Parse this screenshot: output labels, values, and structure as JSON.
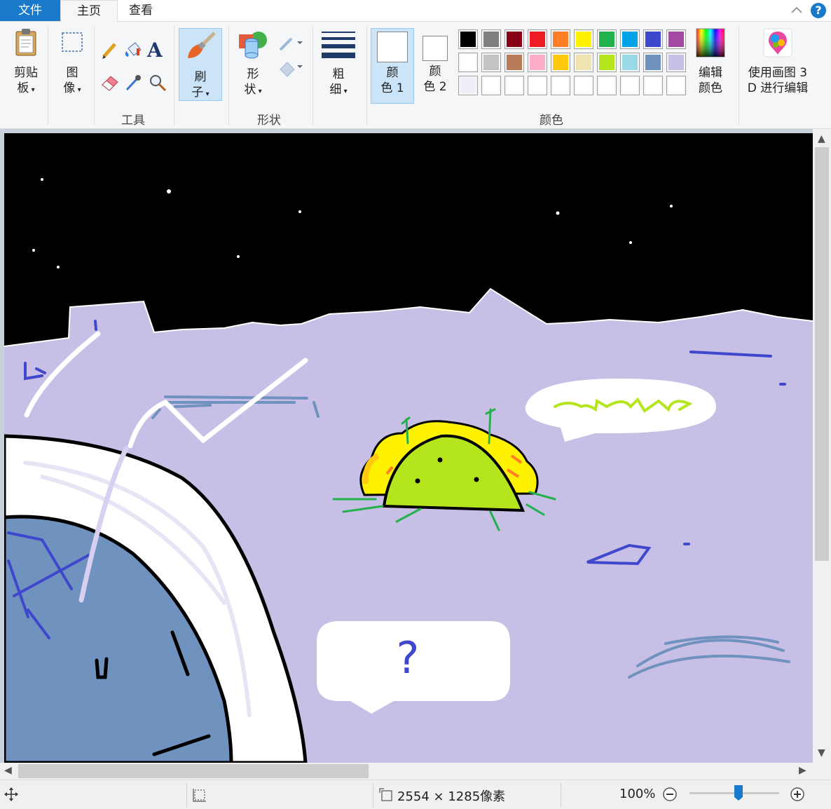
{
  "tabs": {
    "file": "文件",
    "home": "主页",
    "view": "查看"
  },
  "ribbon": {
    "clipboard": {
      "label_l1": "剪贴",
      "label_l2": "板"
    },
    "image": {
      "label_l1": "图",
      "label_l2": "像"
    },
    "tools_group": "工具",
    "brushes": {
      "label_l1": "刷",
      "label_l2": "子"
    },
    "shapes": {
      "label_l1": "形",
      "label_l2": "状",
      "group": "形状"
    },
    "size": {
      "label_l1": "粗",
      "label_l2": "细"
    },
    "color1": {
      "label_l1": "颜",
      "label_l2": "色 1"
    },
    "color2": {
      "label_l1": "颜",
      "label_l2": "色 2"
    },
    "colors_group": "颜色",
    "edit_colors": {
      "label_l1": "编辑",
      "label_l2": "颜色"
    },
    "paint3d": {
      "label_l1": "使用画图 3",
      "label_l2": "D 进行编辑"
    },
    "palette_row1": [
      "#000000",
      "#7f7f7f",
      "#880015",
      "#ed1c24",
      "#ff7f27",
      "#fff200",
      "#22b14c",
      "#00a2e8",
      "#3f48cc",
      "#a349a4"
    ],
    "palette_row2": [
      "#ffffff",
      "#c3c3c3",
      "#b97a57",
      "#ffaec9",
      "#ffc90e",
      "#efe4b0",
      "#b5e61d",
      "#99d9ea",
      "#7092be",
      "#c8bfe7"
    ],
    "palette_row3": [
      "#eeeef6",
      "#ffffff",
      "#ffffff",
      "#ffffff",
      "#ffffff",
      "#ffffff",
      "#ffffff",
      "#ffffff",
      "#ffffff",
      "#ffffff"
    ]
  },
  "canvas_drawing": {
    "bubble_question": "?"
  },
  "status": {
    "dimensions": "2554 × 1285像素",
    "zoom": "100%",
    "zoom_level_fraction": 0.55
  },
  "colors": {
    "accent": "#1979ca",
    "sky": "#000000",
    "ground": "#c8bfe7",
    "planet": "#7092be"
  }
}
